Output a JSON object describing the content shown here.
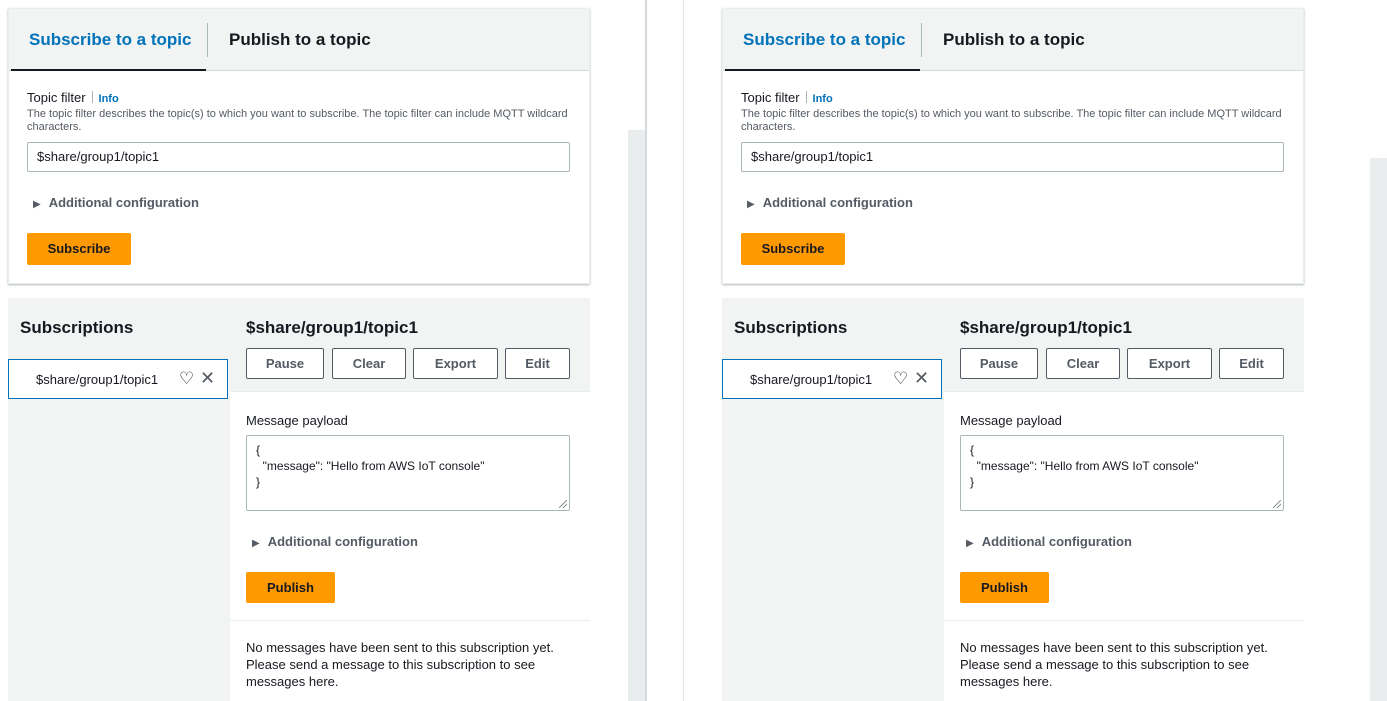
{
  "panes": [
    {
      "tabs": {
        "subscribe": "Subscribe to a topic",
        "publish": "Publish to a topic"
      },
      "topic_filter": {
        "label": "Topic filter",
        "info": "Info",
        "description": "The topic filter describes the topic(s) to which you want to subscribe. The topic filter can include MQTT wildcard characters.",
        "value": "$share/group1/topic1"
      },
      "additional_configuration": "Additional configuration",
      "subscribe_button": "Subscribe",
      "subscriptions": {
        "title": "Subscriptions",
        "items": [
          {
            "label": "$share/group1/topic1"
          }
        ]
      },
      "detail": {
        "title": "$share/group1/topic1",
        "buttons": {
          "pause": "Pause",
          "clear": "Clear",
          "export": "Export",
          "edit": "Edit"
        },
        "payload_label": "Message payload",
        "payload_value": "{\n  \"message\": \"Hello from AWS IoT console\"\n}",
        "additional_configuration": "Additional configuration",
        "publish_button": "Publish",
        "no_messages": "No messages have been sent to this subscription yet. Please send a message to this subscription to see messages here."
      }
    },
    {
      "tabs": {
        "subscribe": "Subscribe to a topic",
        "publish": "Publish to a topic"
      },
      "topic_filter": {
        "label": "Topic filter",
        "info": "Info",
        "description": "The topic filter describes the topic(s) to which you want to subscribe. The topic filter can include MQTT wildcard characters.",
        "value": "$share/group1/topic1"
      },
      "additional_configuration": "Additional configuration",
      "subscribe_button": "Subscribe",
      "subscriptions": {
        "title": "Subscriptions",
        "items": [
          {
            "label": "$share/group1/topic1"
          }
        ]
      },
      "detail": {
        "title": "$share/group1/topic1",
        "buttons": {
          "pause": "Pause",
          "clear": "Clear",
          "export": "Export",
          "edit": "Edit"
        },
        "payload_label": "Message payload",
        "payload_value": "{\n  \"message\": \"Hello from AWS IoT console\"\n}",
        "additional_configuration": "Additional configuration",
        "publish_button": "Publish",
        "no_messages": "No messages have been sent to this subscription yet. Please send a message to this subscription to see messages here."
      }
    }
  ],
  "icons": {
    "expand": "triangle-right-icon",
    "favorite": "heart-outline-icon",
    "remove": "close-icon"
  },
  "colors": {
    "accent": "#0073bb",
    "primary_button": "#ff9900",
    "panel_bg": "#f2f3f3"
  }
}
